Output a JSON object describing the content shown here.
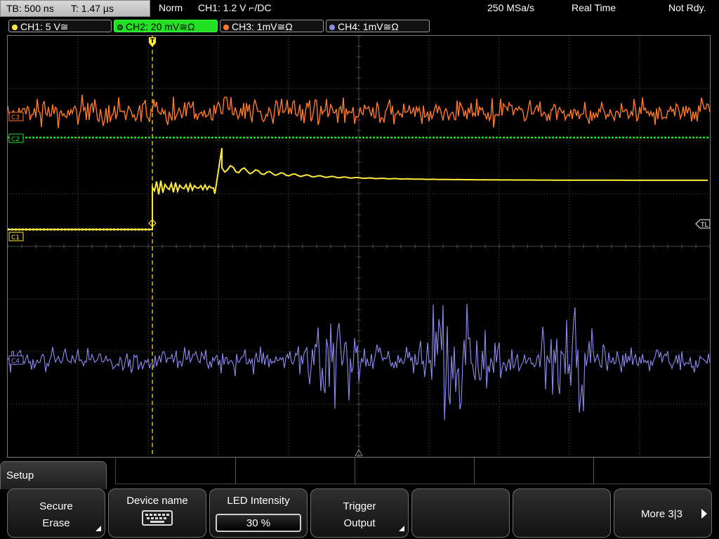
{
  "topbar": {
    "timebase": "TB: 500 ns",
    "trigger_time": "T: 1.47 µs",
    "mode": "Norm",
    "trigger": "CH1: 1.2 V ⌐/DC",
    "sample_rate": "250 MSa/s",
    "acq_mode": "Real Time",
    "ready": "Not Rdy."
  },
  "channels": [
    {
      "label": "CH1: 5 V≅",
      "color": "#ffeb3b"
    },
    {
      "label": "CH2: 20 mV≅Ω",
      "color": "#22e022",
      "active": true
    },
    {
      "label": "CH3: 1mV≅Ω",
      "color": "#ff7a2a"
    },
    {
      "label": "CH4: 1mV≅Ω",
      "color": "#8f8cf0"
    }
  ],
  "markers": {
    "ch1": "C1",
    "ch2": "C2",
    "ch3": "C3",
    "ch4": "C4",
    "trigger_level": "TL",
    "trigger_pos": "T"
  },
  "menu": {
    "title": "Setup",
    "softkeys": [
      {
        "line1": "Secure",
        "line2": "Erase"
      },
      {
        "line1": "Device name",
        "icon": "keyboard-icon"
      },
      {
        "line1": "LED Intensity",
        "value": "30 %"
      },
      {
        "line1": "Trigger",
        "line2": "Output"
      },
      {
        "line1": ""
      },
      {
        "line1": ""
      },
      {
        "line1": "More 3|3"
      }
    ]
  },
  "colors": {
    "ch1": "#ffeb3b",
    "ch2": "#22e022",
    "ch3": "#ff7a2a",
    "ch4": "#8f8cf0",
    "grid": "#555555"
  }
}
